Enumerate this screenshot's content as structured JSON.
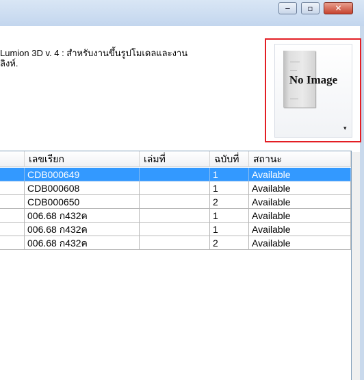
{
  "window": {
    "minimize_symbol": "‒",
    "maximize_symbol": "▫",
    "close_symbol": "✕"
  },
  "info": {
    "line1": "Lumion 3D v. 4 :  สำหรับงานขึ้นรูปโมเดลและงาน",
    "line2": "ิลิงห์."
  },
  "cover": {
    "label": "No Image",
    "dropdown_symbol": "▾"
  },
  "table": {
    "headers": [
      "เลขเรียก",
      "เล่มที่",
      "ฉบับที่",
      "สถานะ"
    ],
    "rows": [
      {
        "call_no": "CDB000649",
        "volume": "",
        "copy": "1",
        "status": "Available",
        "selected": true
      },
      {
        "call_no": "CDB000608",
        "volume": "",
        "copy": "1",
        "status": "Available"
      },
      {
        "call_no": "CDB000650",
        "volume": "",
        "copy": "2",
        "status": "Available"
      },
      {
        "call_no": "006.68 ก432ค",
        "volume": "",
        "copy": "1",
        "status": "Available"
      },
      {
        "call_no": "006.68 ก432ค",
        "volume": "",
        "copy": "1",
        "status": "Available"
      },
      {
        "call_no": "006.68 ก432ค",
        "volume": "",
        "copy": "2",
        "status": "Available"
      }
    ]
  },
  "colors": {
    "selected_row": "#3399ff",
    "highlight_border": "#e31e24"
  }
}
